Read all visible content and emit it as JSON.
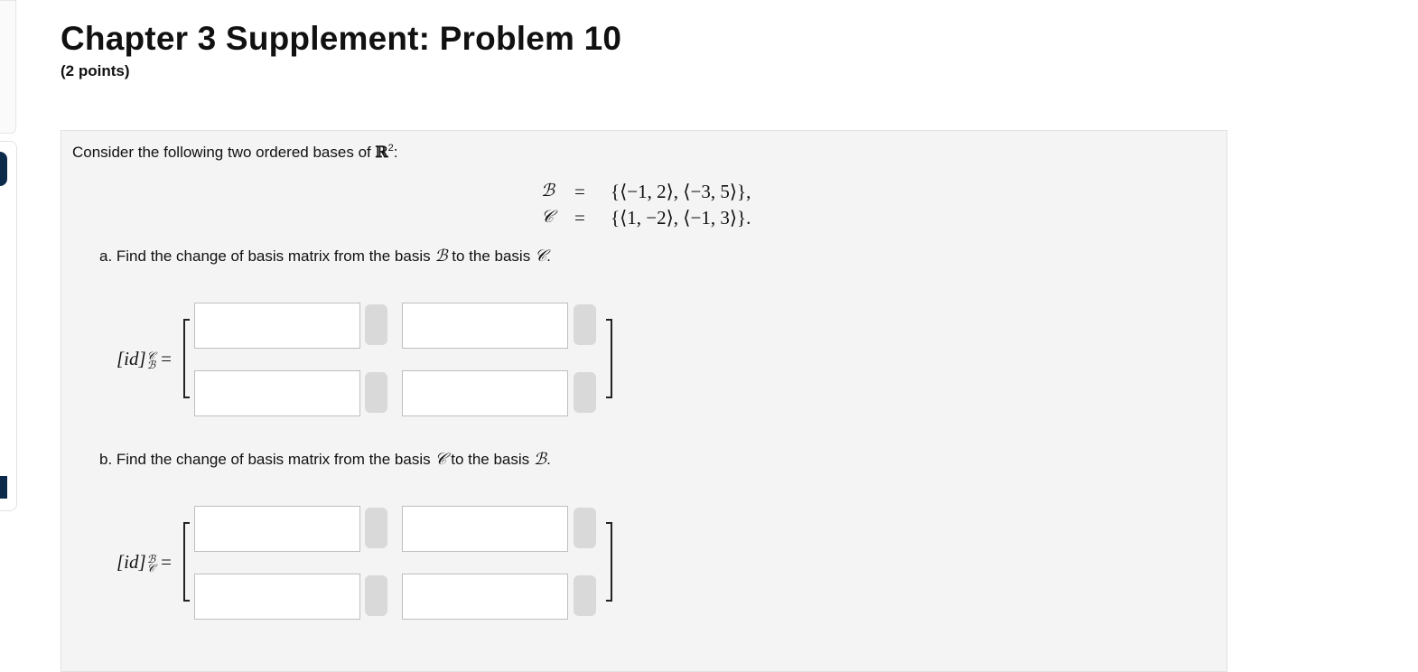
{
  "page": {
    "title": "Chapter 3 Supplement: Problem 10",
    "points": "(2 points)"
  },
  "problem": {
    "intro_text": "Consider the following two ordered bases of",
    "intro_space": "ℝ",
    "intro_exponent": "2",
    "intro_colon": ":",
    "basis_b": {
      "name": "ℬ",
      "equals": "=",
      "value": "{⟨−1, 2⟩, ⟨−3, 5⟩},"
    },
    "basis_c": {
      "name": "𝒞",
      "equals": "=",
      "value": "{⟨1, −2⟩, ⟨−1, 3⟩}."
    },
    "part_a": {
      "text_1": "a. Find the change of basis matrix from the basis",
      "from": "ℬ",
      "text_2": "to the basis",
      "to": "𝒞",
      "text_3": ".",
      "label_main": "[id]",
      "label_sup": "𝒞",
      "label_sub": "ℬ",
      "label_eq": "=",
      "inputs": [
        "",
        "",
        "",
        ""
      ]
    },
    "part_b": {
      "text_1": "b. Find the change of basis matrix from the basis",
      "from": "𝒞",
      "text_2": "to the basis",
      "to": "ℬ",
      "text_3": ".",
      "label_main": "[id]",
      "label_sup": "ℬ",
      "label_sub": "𝒞",
      "label_eq": "=",
      "inputs": [
        "",
        "",
        "",
        ""
      ]
    }
  }
}
